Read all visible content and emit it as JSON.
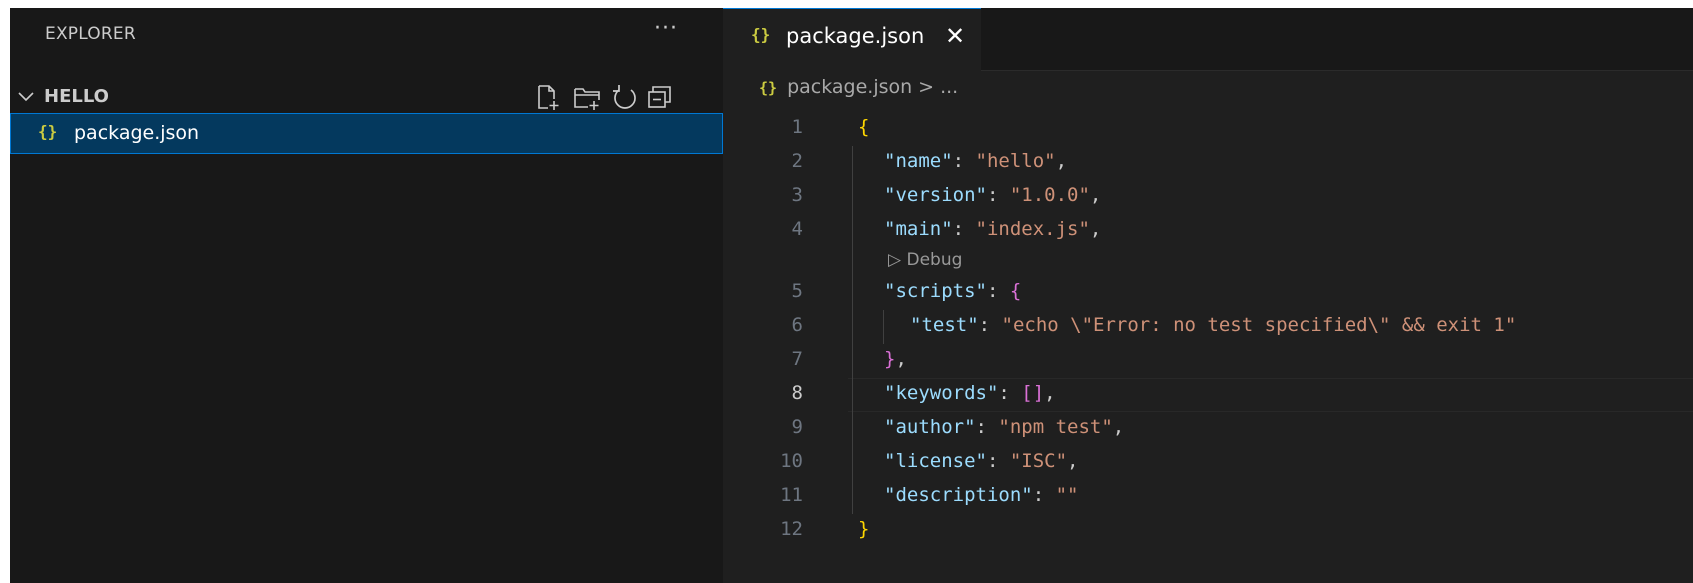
{
  "sidebar": {
    "title": "EXPLORER",
    "more_label": "···",
    "folder": {
      "name": "HELLO",
      "actions": [
        "new-file-icon",
        "new-folder-icon",
        "refresh-icon",
        "collapse-all-icon"
      ]
    },
    "files": [
      {
        "icon": "{}",
        "name": "package.json"
      }
    ]
  },
  "editor": {
    "tab": {
      "icon": "{}",
      "label": "package.json",
      "close": "✕"
    },
    "breadcrumb": {
      "icon": "{}",
      "file": "package.json",
      "separator": ">",
      "rest": "..."
    },
    "codelens": "Debug",
    "active_line": 8,
    "line_numbers": [
      "1",
      "2",
      "3",
      "4",
      "5",
      "6",
      "7",
      "8",
      "9",
      "10",
      "11",
      "12"
    ],
    "lines": [
      [
        [
          "b1",
          "{"
        ]
      ],
      [
        [
          "k",
          "\"name\""
        ],
        [
          "p",
          ": "
        ],
        [
          "s",
          "\"hello\""
        ],
        [
          "p",
          ","
        ]
      ],
      [
        [
          "k",
          "\"version\""
        ],
        [
          "p",
          ": "
        ],
        [
          "s",
          "\"1.0.0\""
        ],
        [
          "p",
          ","
        ]
      ],
      [
        [
          "k",
          "\"main\""
        ],
        [
          "p",
          ": "
        ],
        [
          "s",
          "\"index.js\""
        ],
        [
          "p",
          ","
        ]
      ],
      [
        [
          "k",
          "\"scripts\""
        ],
        [
          "p",
          ": "
        ],
        [
          "b2",
          "{"
        ]
      ],
      [
        [
          "k",
          "\"test\""
        ],
        [
          "p",
          ": "
        ],
        [
          "s",
          "\"echo \\\"Error: no test specified\\\" && exit 1\""
        ]
      ],
      [
        [
          "b2",
          "}"
        ],
        [
          "p",
          ","
        ]
      ],
      [
        [
          "k",
          "\"keywords\""
        ],
        [
          "p",
          ": "
        ],
        [
          "b2",
          "[]"
        ],
        [
          "p",
          ","
        ]
      ],
      [
        [
          "k",
          "\"author\""
        ],
        [
          "p",
          ": "
        ],
        [
          "s",
          "\"npm test\""
        ],
        [
          "p",
          ","
        ]
      ],
      [
        [
          "k",
          "\"license\""
        ],
        [
          "p",
          ": "
        ],
        [
          "s",
          "\"ISC\""
        ],
        [
          "p",
          ","
        ]
      ],
      [
        [
          "k",
          "\"description\""
        ],
        [
          "p",
          ": "
        ],
        [
          "s",
          "\"\""
        ]
      ],
      [
        [
          "b1",
          "}"
        ]
      ]
    ]
  }
}
